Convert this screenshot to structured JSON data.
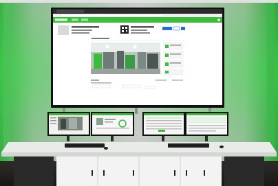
{
  "photo": {
    "subject": "control-room-display-wall",
    "accent_color": "#3dbb3d",
    "glow_color": "#39e24a",
    "wall_color": "#c9ccc9",
    "desk_color": "#e9ebe9"
  },
  "screens": {
    "wall_display": {
      "app_header": "",
      "panel_count": 1
    },
    "monitors": [
      {
        "kind": "camera-feed"
      },
      {
        "kind": "device-status"
      },
      {
        "kind": "list"
      },
      {
        "kind": "dashboard"
      }
    ]
  }
}
